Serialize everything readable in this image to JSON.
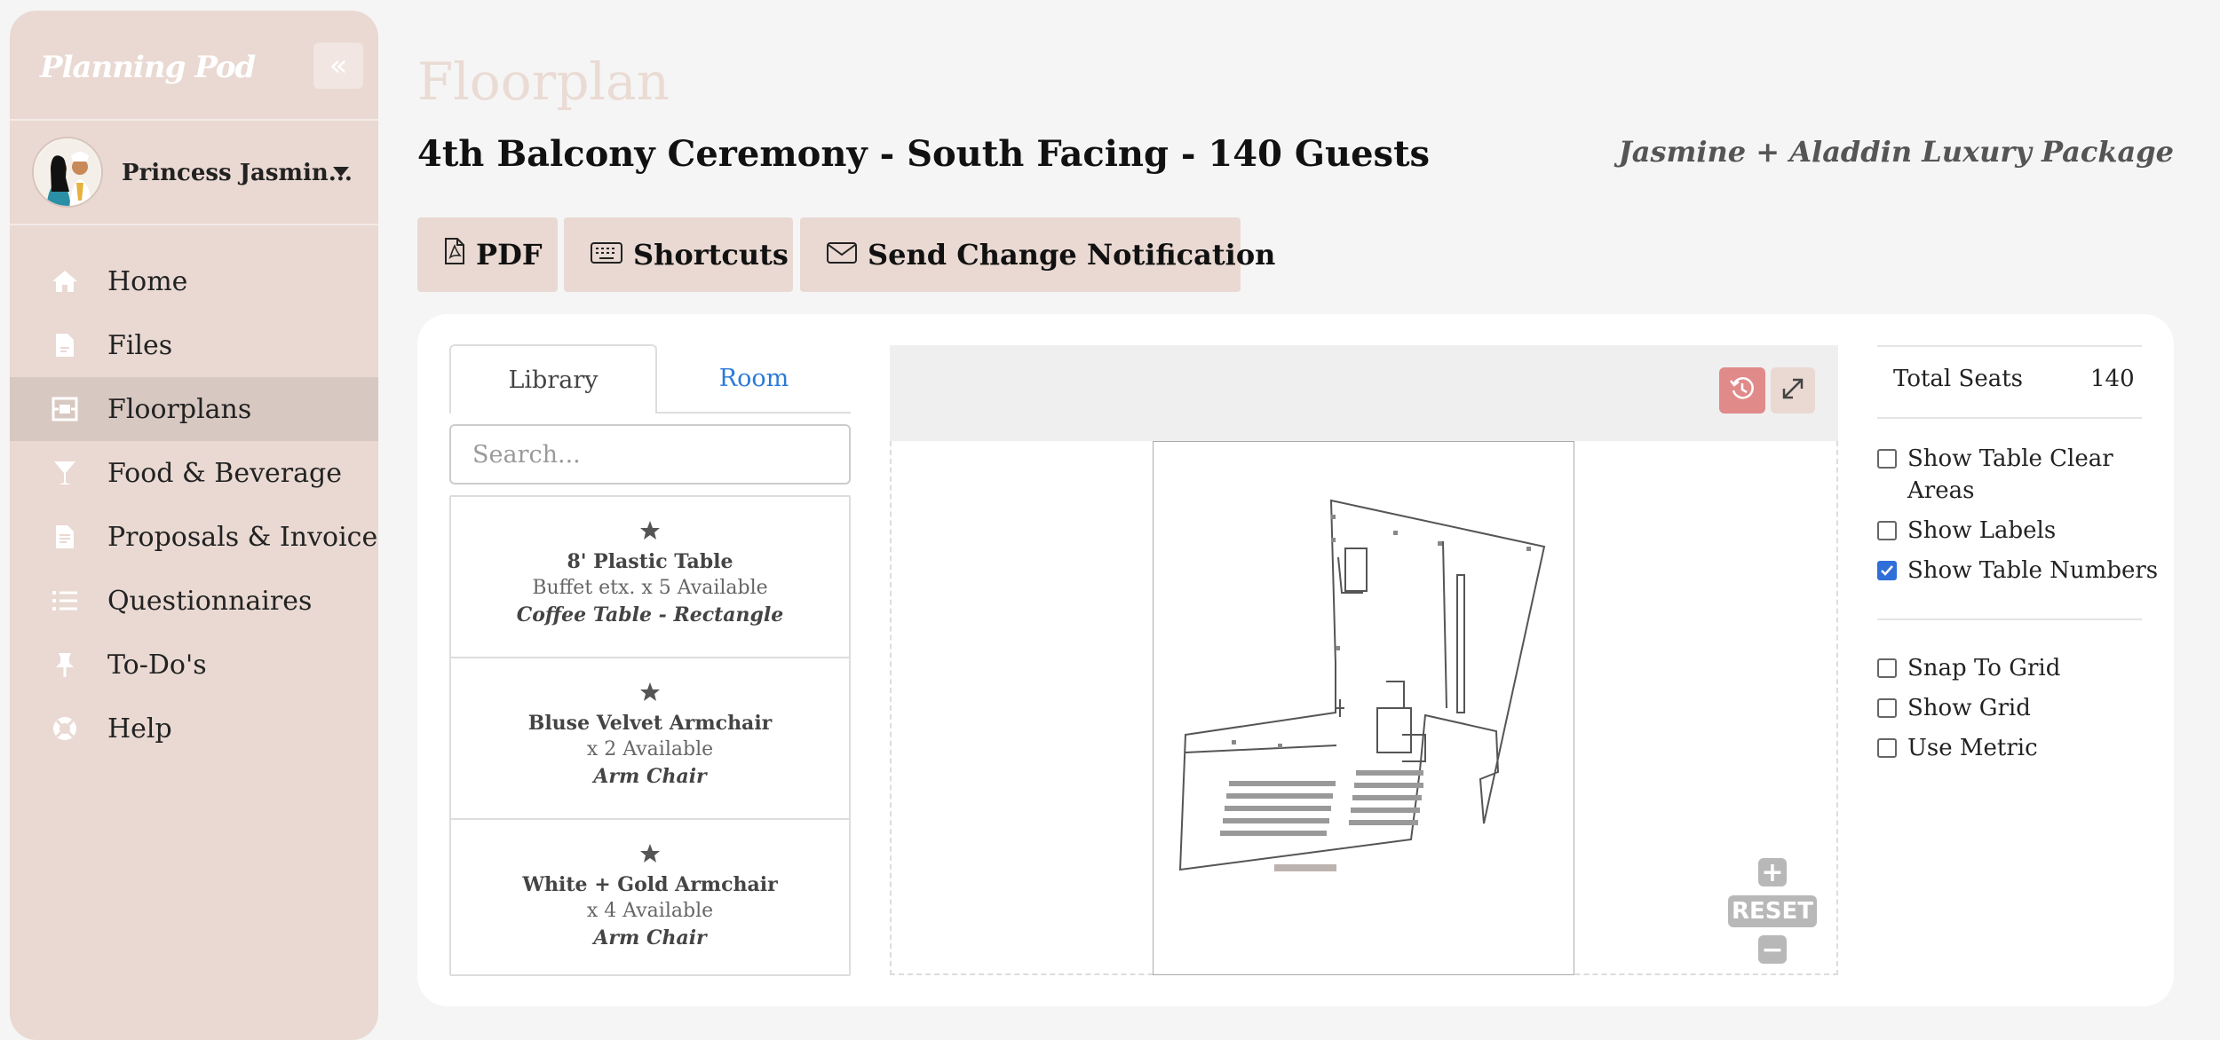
{
  "sidebar": {
    "brand": "Planning Pod",
    "user_name": "Princess Jasmin...",
    "items": [
      {
        "label": "Home",
        "icon": "home-icon"
      },
      {
        "label": "Files",
        "icon": "file-icon"
      },
      {
        "label": "Floorplans",
        "icon": "floorplan-icon",
        "active": true
      },
      {
        "label": "Food & Beverage",
        "icon": "cocktail-icon"
      },
      {
        "label": "Proposals & Invoices",
        "icon": "invoice-icon"
      },
      {
        "label": "Questionnaires",
        "icon": "list-icon"
      },
      {
        "label": "To-Do's",
        "icon": "pin-icon"
      },
      {
        "label": "Help",
        "icon": "lifebuoy-icon"
      }
    ]
  },
  "header": {
    "title": "Floorplan",
    "subtitle": "4th Balcony Ceremony - South Facing - 140 Guests",
    "package": "Jasmine + Aladdin Luxury Package"
  },
  "toolbar": {
    "pdf_label": "PDF",
    "shortcuts_label": "Shortcuts",
    "notify_label": "Send Change Notification"
  },
  "library": {
    "tabs": [
      "Library",
      "Room"
    ],
    "active_tab": "Library",
    "search_placeholder": "Search...",
    "items": [
      {
        "name": "8' Plastic Table",
        "availability": "Buffet etx. x 5 Available",
        "type": "Coffee Table - Rectangle"
      },
      {
        "name": "Bluse Velvet Armchair",
        "availability": "x 2 Available",
        "type": "Arm Chair"
      },
      {
        "name": "White + Gold Armchair",
        "availability": "x 4 Available",
        "type": "Arm Chair"
      }
    ]
  },
  "canvas": {
    "zoom_reset_label": "RESET",
    "zoom_in_label": "+",
    "zoom_out_label": "−"
  },
  "settings": {
    "total_seats_label": "Total Seats",
    "total_seats_value": "140",
    "options_group1": [
      {
        "label": "Show Table Clear Areas",
        "checked": false
      },
      {
        "label": "Show Labels",
        "checked": false
      },
      {
        "label": "Show Table Numbers",
        "checked": true
      }
    ],
    "options_group2": [
      {
        "label": "Snap To Grid",
        "checked": false
      },
      {
        "label": "Show Grid",
        "checked": false
      },
      {
        "label": "Use Metric",
        "checked": false
      }
    ]
  },
  "colors": {
    "sidebar_bg": "#e9d9d2",
    "accent_link": "#2a7ad8",
    "history_button": "#e08a8a"
  }
}
